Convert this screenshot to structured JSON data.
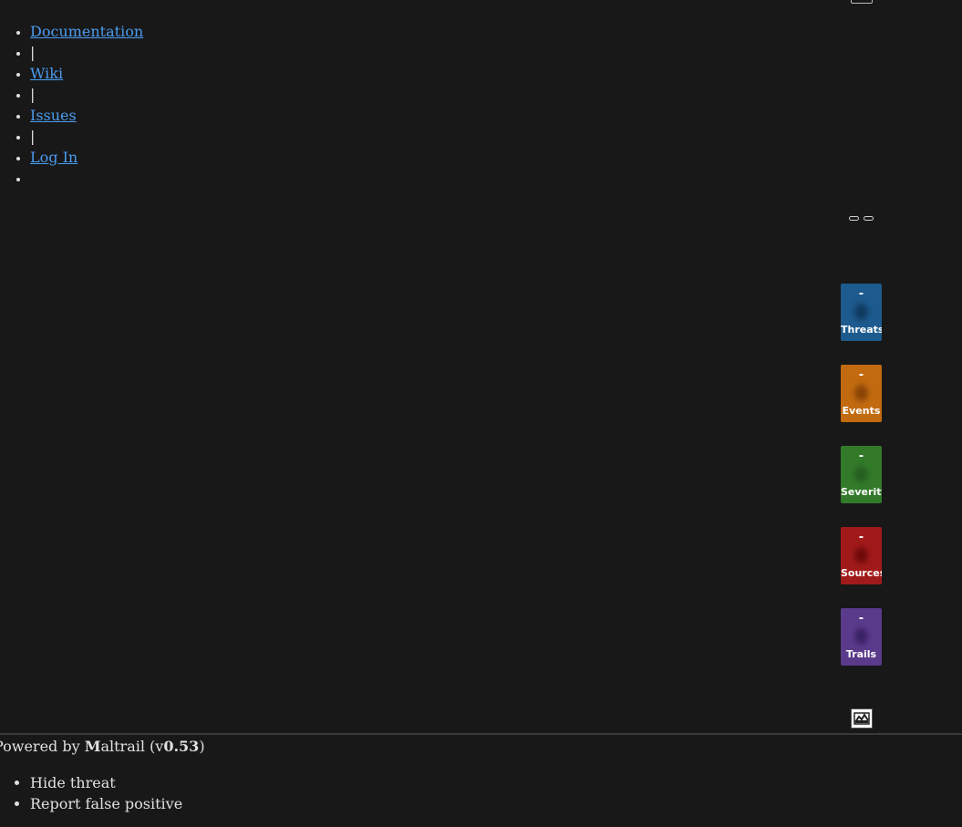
{
  "nav": {
    "items": [
      {
        "type": "link",
        "label": "Documentation"
      },
      {
        "type": "sep",
        "label": "|"
      },
      {
        "type": "link",
        "label": "Wiki"
      },
      {
        "type": "sep",
        "label": "|"
      },
      {
        "type": "link",
        "label": "Issues"
      },
      {
        "type": "sep",
        "label": "|"
      },
      {
        "type": "link",
        "label": "Log In"
      },
      {
        "type": "empty",
        "label": ""
      }
    ]
  },
  "stats": [
    {
      "value": "-",
      "label": "Threats",
      "color": "#1d5a8e",
      "blob": "#113a60"
    },
    {
      "value": "-",
      "label": "Events",
      "color": "#c26a10",
      "blob": "#8a4406"
    },
    {
      "value": "-",
      "label": "Severity",
      "color": "#327a2a",
      "blob": "#275f20"
    },
    {
      "value": "-",
      "label": "Sources",
      "color": "#a11a1a",
      "blob": "#6e0a0a"
    },
    {
      "value": "-",
      "label": "Trails",
      "color": "#5a3a8a",
      "blob": "#3a2266"
    }
  ],
  "footer": {
    "prefix": "Powered by ",
    "brand_initial": "M",
    "brand_rest": "altrail",
    "version_open": " (v",
    "version": "0.53",
    "version_close": ")"
  },
  "context_menu": {
    "items": [
      "Hide threat",
      "Report false positive"
    ]
  },
  "icons": {
    "top": "panel-icon",
    "chart": "chart-icon"
  }
}
